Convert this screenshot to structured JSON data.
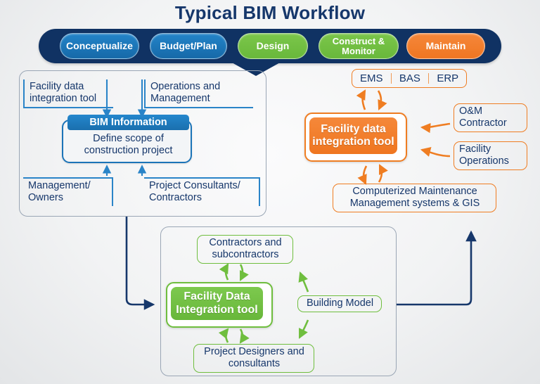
{
  "title": "Typical BIM Workflow",
  "colors": {
    "navy": "#103263",
    "blue": "#2384c9",
    "green": "#6fbe3e",
    "orange": "#ef7d22",
    "text_navy": "#16376b",
    "panel_border": "#9aa6b5"
  },
  "phases": [
    {
      "label": "Conceptualize",
      "color": "#2384c9",
      "style": "blue"
    },
    {
      "label": "Budget/Plan",
      "color": "#2384c9",
      "style": "blue"
    },
    {
      "label": "Design",
      "color": "#6fbe3e",
      "style": "green"
    },
    {
      "label": "Construct & Monitor",
      "color": "#6fbe3e",
      "style": "green"
    },
    {
      "label": "Maintain",
      "color": "#ef7d22",
      "style": "orng"
    }
  ],
  "left_panel": {
    "labels": {
      "top_left": "Facility data integration tool",
      "top_right": "Operations and Management",
      "bottom_left": "Management/ Owners",
      "bottom_right": "Project Consultants/ Contractors"
    },
    "card": {
      "header": "BIM Information",
      "line1": "Define scope of",
      "line2": "construction project"
    }
  },
  "right_panel": {
    "systems": [
      "EMS",
      "BAS",
      "ERP"
    ],
    "card": {
      "line1": "Facility data",
      "line2": "integration tool"
    },
    "sources": [
      {
        "line1": "O&M",
        "line2": "Contractor"
      },
      {
        "line1": "Facility",
        "line2": "Operations"
      }
    ],
    "cmms": {
      "line1": "Computerized Maintenance",
      "line2": "Management systems   & GIS"
    }
  },
  "green_panel": {
    "top_box": {
      "line1": "Contractors and",
      "line2": "subcontractors"
    },
    "card": {
      "line1": "Facility Data",
      "line2": "Integration tool"
    },
    "side_box": {
      "line1": "Building Model"
    },
    "bottom_box": {
      "line1": "Project Designers and",
      "line2": "consultants"
    }
  }
}
